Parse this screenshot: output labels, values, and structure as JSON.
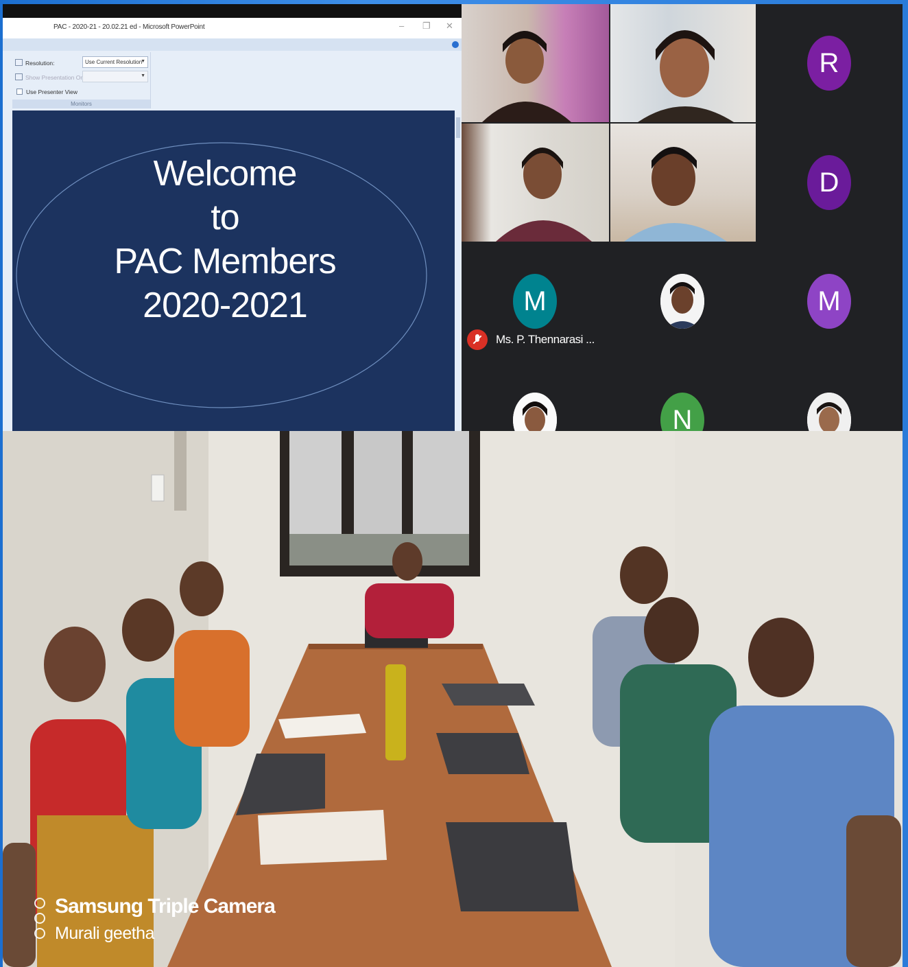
{
  "powerpoint": {
    "window_title": "PAC - 2020-21 - 20.02.21 ed - Microsoft PowerPoint",
    "minimize_glyph": "–",
    "restore_glyph": "❐",
    "close_glyph": "✕",
    "ribbon": {
      "resolution_label": "Resolution:",
      "resolution_value": "Use Current Resolution",
      "show_presentation_on_label": "Show Presentation On:",
      "use_presenter_view_label": "Use Presenter View",
      "group_label": "Monitors"
    },
    "slide": {
      "line1": "Welcome",
      "line2": "to",
      "line3": "PAC Members",
      "line4": "2020-2021"
    }
  },
  "meeting": {
    "avatars": [
      {
        "letter": "R",
        "color": "#7b1fa2"
      },
      {
        "letter": "D",
        "color": "#6a1b9a"
      },
      {
        "letter": "M",
        "color": "#00838f"
      },
      {
        "letter": "M",
        "color": "#8e44c5"
      },
      {
        "letter": "N",
        "color": "#43a047"
      }
    ],
    "muted_participant": "Ms. P. Thennarasi ..."
  },
  "watermark": {
    "camera": "Samsung Triple Camera",
    "author": "Murali geetha"
  }
}
